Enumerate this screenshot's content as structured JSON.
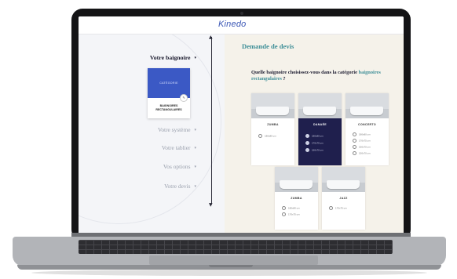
{
  "app": {
    "logo": "Kinedo"
  },
  "page": {
    "title": "Demande de devis",
    "question_prefix": "Quelle baignoire choisissez-vous dans la catégorie",
    "question_highlight": "baignoires rectangulaires",
    "question_suffix": " ?"
  },
  "steps": [
    {
      "label": "Votre baignoire",
      "chev": "▾"
    },
    {
      "label": "Votre système",
      "chev": "▾"
    },
    {
      "label": "Votre tablier",
      "chev": "▾"
    },
    {
      "label": "Vos options",
      "chev": "▾"
    },
    {
      "label": "Votre devis",
      "chev": "▾"
    }
  ],
  "category_card": {
    "header": "CATÉGORIE",
    "label": "BAIGNOIRES RECTANGULAIRES",
    "edit_icon": "pencil-icon"
  },
  "products": [
    {
      "name": "ZUMBA",
      "selected": false,
      "sizes": [
        "180x80 cm"
      ]
    },
    {
      "name": "DANAÉE",
      "selected": true,
      "sizes": [
        "180x80 cm",
        "170x75 cm",
        "160x70 cm"
      ]
    },
    {
      "name": "CONCERTO",
      "selected": false,
      "sizes": [
        "180x80 cm",
        "170x75 cm",
        "160x70 cm",
        "150x70 cm"
      ]
    },
    {
      "name": "ZUMBA",
      "selected": false,
      "sizes": [
        "180x80 cm",
        "170x75 cm"
      ]
    },
    {
      "name": "JAZZ",
      "selected": false,
      "sizes": [
        "170x75 cm"
      ]
    }
  ],
  "colors": {
    "accent": "#3f8f98",
    "brand_blue": "#3b59c5",
    "selected_card": "#1f1f4d"
  }
}
